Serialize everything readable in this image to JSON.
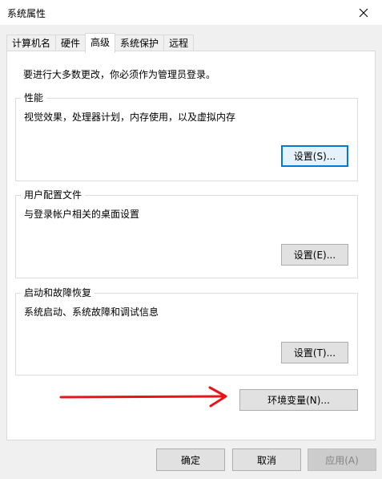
{
  "window": {
    "title": "系统属性",
    "close_icon": "close-icon"
  },
  "tabs": [
    {
      "label": "计算机名",
      "active": false
    },
    {
      "label": "硬件",
      "active": false
    },
    {
      "label": "高级",
      "active": true
    },
    {
      "label": "系统保护",
      "active": false
    },
    {
      "label": "远程",
      "active": false
    }
  ],
  "advanced": {
    "admin_note": "要进行大多数更改，你必须作为管理员登录。",
    "performance": {
      "legend": "性能",
      "description": "视觉效果，处理器计划，内存使用，以及虚拟内存",
      "button": "设置(S)..."
    },
    "user_profiles": {
      "legend": "用户配置文件",
      "description": "与登录帐户相关的桌面设置",
      "button": "设置(E)..."
    },
    "startup_recovery": {
      "legend": "启动和故障恢复",
      "description": "系统启动、系统故障和调试信息",
      "button": "设置(T)..."
    },
    "env_vars_button": "环境变量(N)..."
  },
  "footer": {
    "ok": "确定",
    "cancel": "取消",
    "apply": "应用(A)"
  },
  "colors": {
    "focus_border": "#0078d7",
    "arrow": "#e8141a"
  }
}
